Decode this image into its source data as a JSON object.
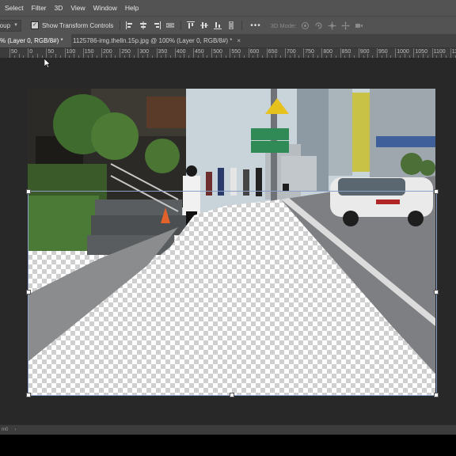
{
  "menubar": {
    "items": [
      "Select",
      "Filter",
      "3D",
      "View",
      "Window",
      "Help"
    ]
  },
  "options": {
    "group_select": "roup",
    "show_transform_label": "Show Transform Controls",
    "mode_label": "3D Mode:",
    "align_icons": [
      "align-left-edges-icon",
      "align-horizontal-centers-icon",
      "align-right-edges-icon",
      "distribute-icon",
      "align-top-edges-icon",
      "align-vertical-centers-icon",
      "align-bottom-edges-icon",
      "distribute-vertical-icon"
    ],
    "three_d_icons": [
      "orbit-3d-icon",
      "roll-3d-icon",
      "pan-3d-icon",
      "slide-3d-icon",
      "scale-3d-camera-icon"
    ]
  },
  "tabs": {
    "active": "% (Layer 0, RGB/8#) *",
    "inactive": "1125786-img.thelln.15p.jpg @ 100% (Layer 0, RGB/8#) *",
    "close_glyph": "×"
  },
  "ruler": {
    "labels": [
      "50",
      "0",
      "50",
      "100",
      "150",
      "200",
      "250",
      "300",
      "350",
      "400",
      "450",
      "500",
      "550",
      "600",
      "650",
      "700",
      "750",
      "800",
      "850",
      "900",
      "950",
      "1000",
      "1050",
      "1100",
      "1150",
      "1200",
      "125"
    ]
  },
  "status": {
    "text": "m0"
  },
  "colors": {
    "app_bg": "#535353",
    "canvas_bg": "#282828",
    "selection_box": "#8aa0c8"
  }
}
